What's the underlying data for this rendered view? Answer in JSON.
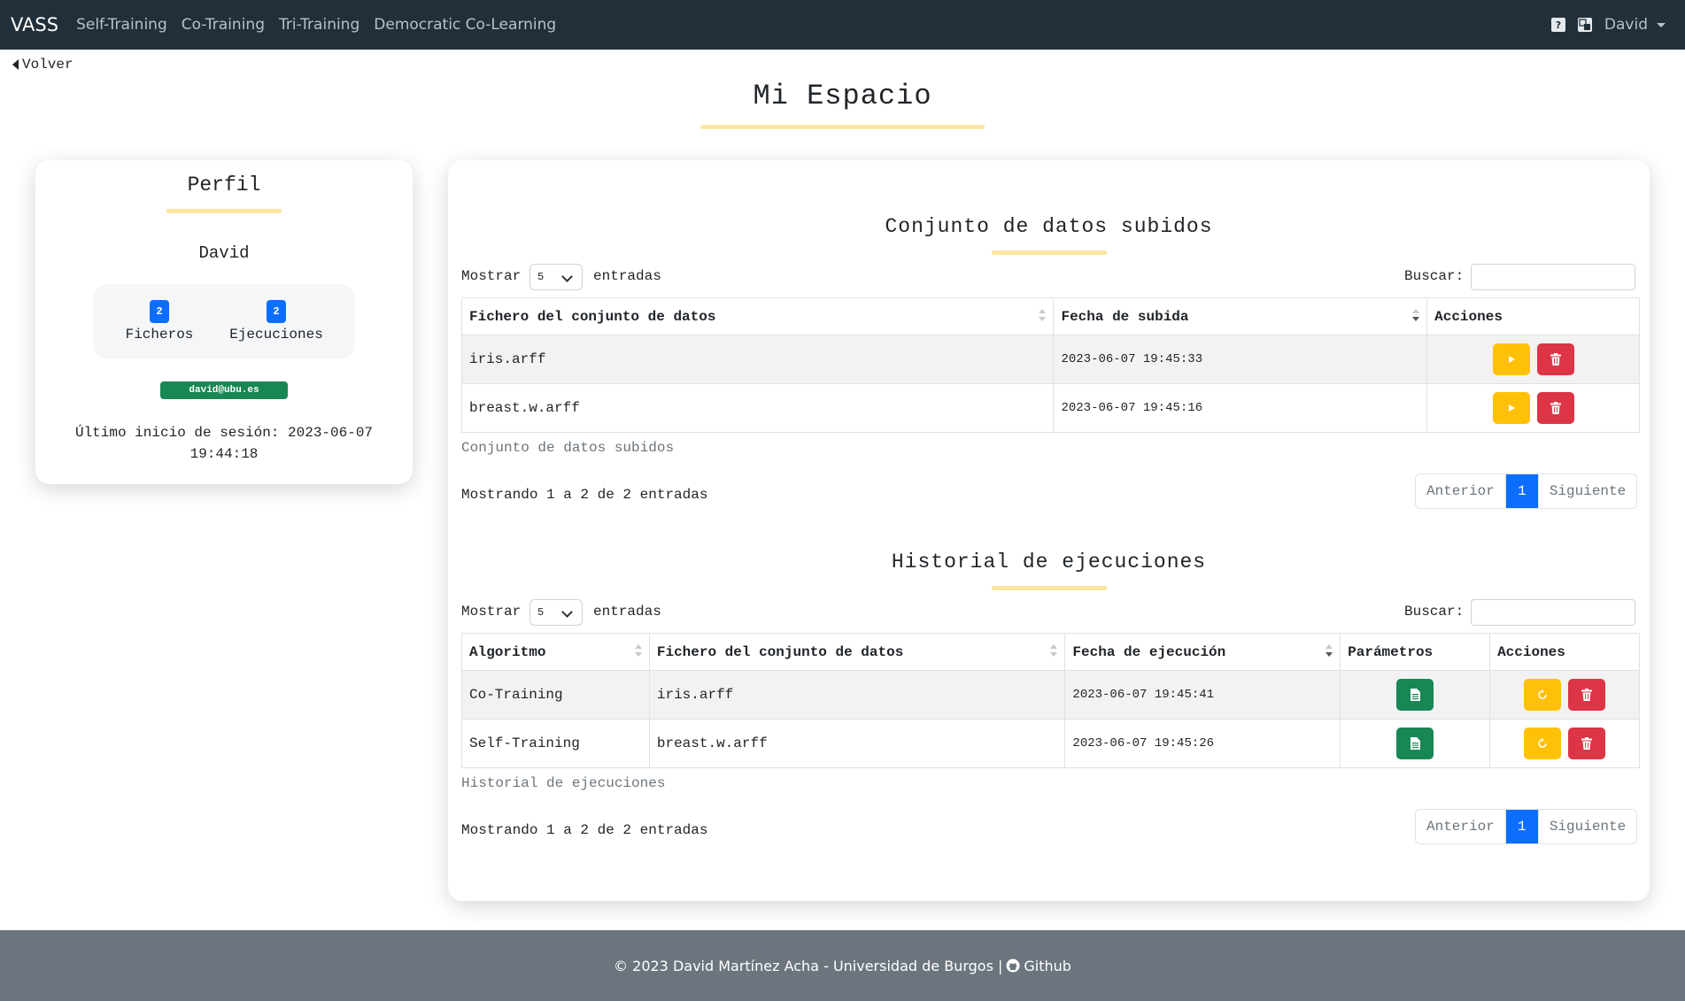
{
  "navbar": {
    "brand": "VASS",
    "links": [
      "Self-Training",
      "Co-Training",
      "Tri-Training",
      "Democratic Co-Learning"
    ],
    "help_icon": "question-icon",
    "lang_icon": "translate-icon",
    "user": "David"
  },
  "back": {
    "label": "Volver"
  },
  "page": {
    "title": "Mi Espacio"
  },
  "profile": {
    "title": "Perfil",
    "name": "David",
    "files_count": "2",
    "files_label": "Ficheros",
    "runs_count": "2",
    "runs_label": "Ejecuciones",
    "email": "david@ubu.es",
    "last_login_line1": "Último inicio de sesión: 2023-06-07",
    "last_login_line2": "19:44:18"
  },
  "datasets": {
    "title": "Conjunto de datos subidos",
    "show_label": "Mostrar",
    "entries_label": "entradas",
    "page_size": "5",
    "search_label": "Buscar:",
    "search_value": "",
    "headers": [
      "Fichero del conjunto de datos",
      "Fecha de subida",
      "Acciones"
    ],
    "rows": [
      {
        "file": "iris.arff",
        "date": "2023-06-07 19:45:33"
      },
      {
        "file": "breast.w.arff",
        "date": "2023-06-07 19:45:16"
      }
    ],
    "caption": "Conjunto de datos subidos",
    "info": "Mostrando 1 a 2 de 2 entradas",
    "prev": "Anterior",
    "page": "1",
    "next": "Siguiente"
  },
  "runs": {
    "title": "Historial de ejecuciones",
    "show_label": "Mostrar",
    "entries_label": "entradas",
    "page_size": "5",
    "search_label": "Buscar:",
    "search_value": "",
    "headers": [
      "Algoritmo",
      "Fichero del conjunto de datos",
      "Fecha de ejecución",
      "Parámetros",
      "Acciones"
    ],
    "rows": [
      {
        "algorithm": "Co-Training",
        "file": "iris.arff",
        "date": "2023-06-07 19:45:41"
      },
      {
        "algorithm": "Self-Training",
        "file": "breast.w.arff",
        "date": "2023-06-07 19:45:26"
      }
    ],
    "caption": "Historial de ejecuciones",
    "info": "Mostrando 1 a 2 de 2 entradas",
    "prev": "Anterior",
    "page": "1",
    "next": "Siguiente"
  },
  "footer": {
    "text": "© 2023 David Martínez Acha - Universidad de Burgos |",
    "github": "Github"
  },
  "colors": {
    "navbar": "#212f3a",
    "accent_underline": "#fbe7a3",
    "primary": "#0d6efd",
    "warning": "#ffc107",
    "danger": "#dc3545",
    "success": "#198754",
    "footer": "#6c757d"
  }
}
